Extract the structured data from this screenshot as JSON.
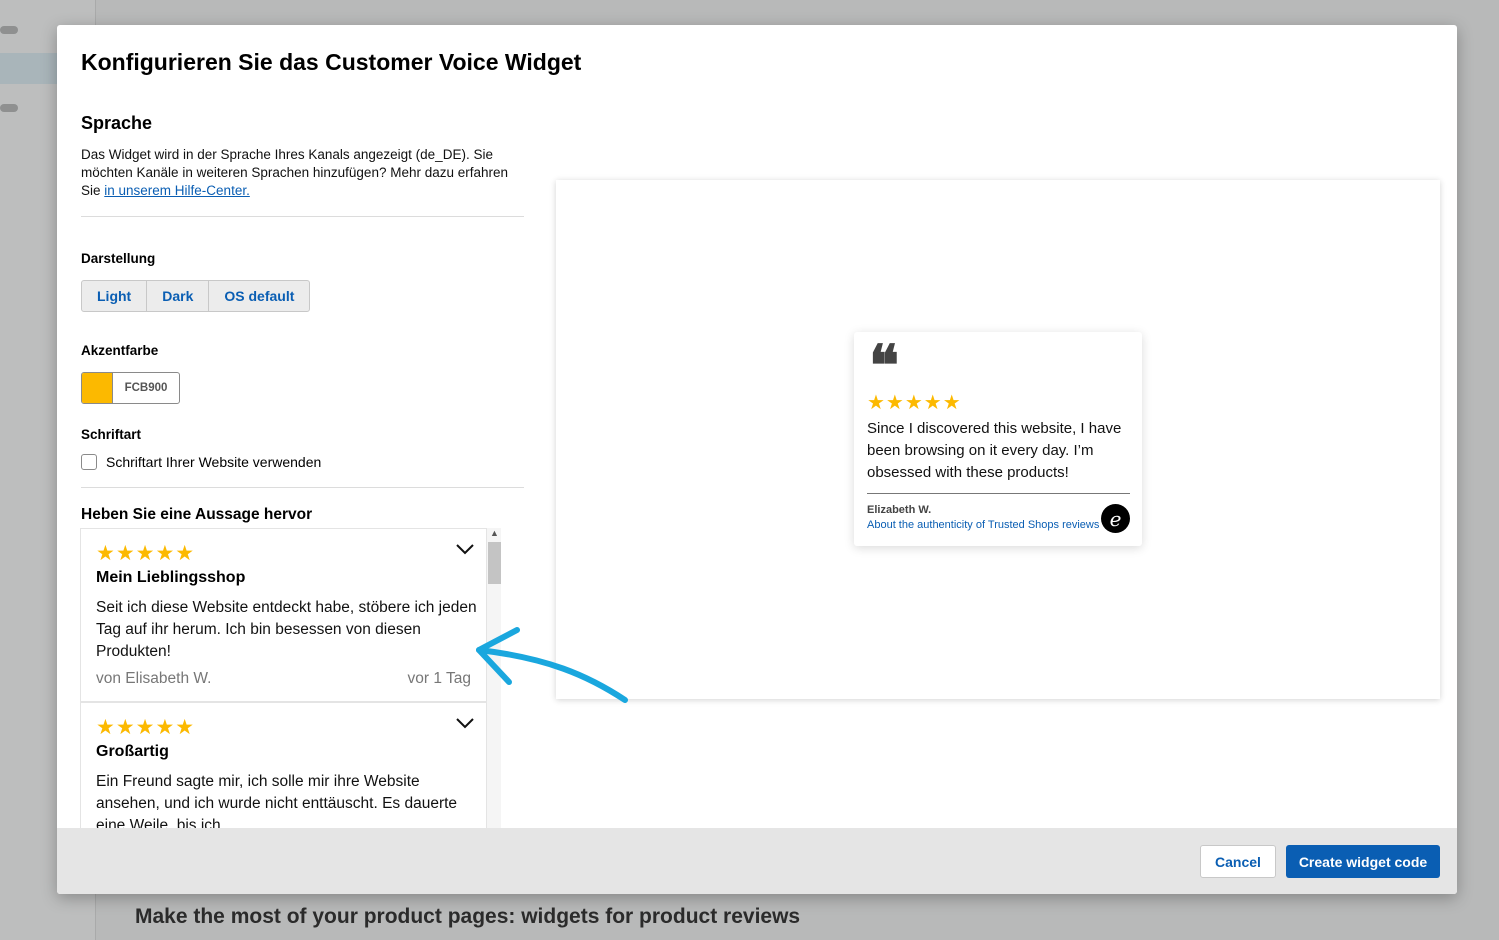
{
  "background": {
    "heading": "Make the most of your product pages: widgets for product reviews"
  },
  "modal": {
    "title": "Konfigurieren Sie das Customer Voice Widget",
    "language": {
      "title": "Sprache",
      "text": "Das Widget wird in der Sprache Ihres Kanals angezeigt (de_DE). Sie möchten Kanäle in weiteren Sprachen hinzufügen? Mehr dazu erfahren Sie ",
      "link": "in unserem Hilfe-Center."
    },
    "appearance": {
      "label": "Darstellung",
      "options": [
        "Light",
        "Dark",
        "OS default"
      ]
    },
    "accent": {
      "label": "Akzentfarbe",
      "hex": "FCB900",
      "color": "#FCB900"
    },
    "font": {
      "label": "Schriftart",
      "checkbox_label": "Schriftart Ihrer Website verwenden",
      "checked": false
    },
    "highlight": {
      "label": "Heben Sie eine Aussage hervor",
      "reviews": [
        {
          "stars": "★★★★★",
          "rating": 5,
          "title": "Mein Lieblingsshop",
          "body": "Seit ich diese Website entdeckt habe, stöbere ich jeden Tag auf ihr herum. Ich bin besessen von diesen Produkten!",
          "author": "von Elisabeth W.",
          "time": "vor 1 Tag"
        },
        {
          "stars": "★★★★★",
          "rating": 5,
          "title": "Großartig",
          "body": "Ein Freund sagte mir, ich solle mir ihre Website ansehen, und ich wurde nicht enttäuscht. Es dauerte eine Weile, bis ich ..."
        }
      ]
    },
    "preview": {
      "quote_mark": "❝",
      "stars": "★★★★★",
      "rating": 5,
      "text": "Since I discovered this website, I have been browsing on it every day. I’m obsessed with these products!",
      "author": "Elizabeth W.",
      "link": "About the authenticity of Trusted Shops reviews",
      "logo_glyph": "e"
    },
    "footer": {
      "cancel": "Cancel",
      "create": "Create widget code"
    }
  },
  "colors": {
    "accent_blue": "#0A5EB3",
    "star_yellow": "#FCB900",
    "arrow_blue": "#1AA7DE"
  }
}
